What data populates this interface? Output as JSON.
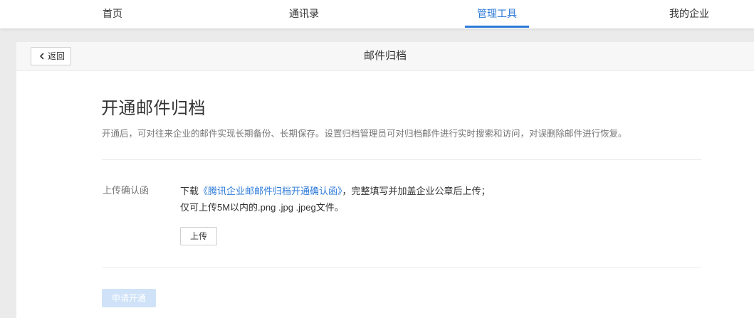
{
  "nav": {
    "items": [
      {
        "label": "首页",
        "active": false
      },
      {
        "label": "通讯录",
        "active": false
      },
      {
        "label": "管理工具",
        "active": true
      },
      {
        "label": "我的企业",
        "active": false
      }
    ],
    "accent_color": "#2e7bd9"
  },
  "header": {
    "back_label": "返回",
    "back_icon": "chevron-left-icon",
    "title": "邮件归档"
  },
  "main": {
    "heading": "开通邮件归档",
    "description": "开通后，可对往来企业的邮件实现长期备份、长期保存。设置归档管理员可对归档邮件进行实时搜索和访问，对误删除邮件进行恢复。",
    "upload_section": {
      "label": "上传确认函",
      "instruction_prefix": "下载",
      "instruction_link": "《腾讯企业邮邮件归档开通确认函》",
      "instruction_suffix": "，完整填写并加盖企业公章后上传；",
      "instruction_line2": "仅可上传5M以内的.png .jpg .jpeg文件。",
      "upload_button": "上传"
    },
    "apply_button": "申请开通",
    "apply_disabled": true
  }
}
